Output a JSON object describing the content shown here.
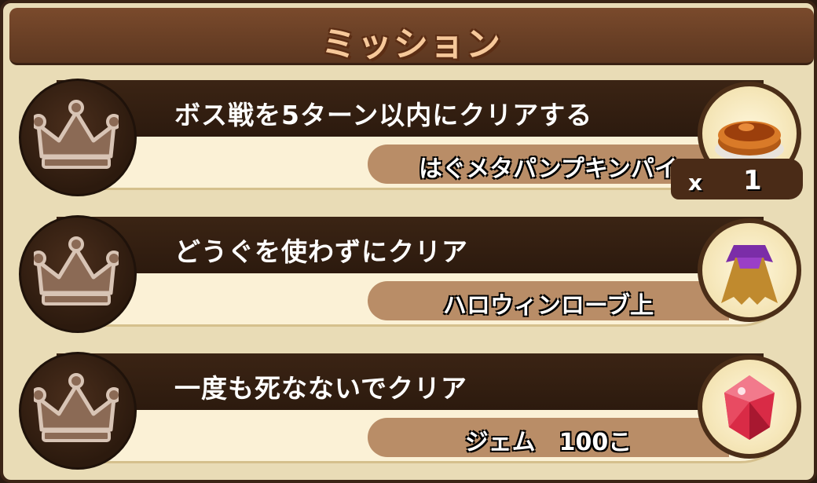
{
  "header": {
    "title": "ミッション"
  },
  "missions": [
    {
      "text": "ボス戦を5ターン以内にクリアする",
      "reward": "はぐメタパンプキンパイ",
      "reward_icon": "pie-icon",
      "qty_x": "x",
      "qty": "1"
    },
    {
      "text": "どうぐを使わずにクリア",
      "reward": "ハロウィンローブ上",
      "reward_icon": "robe-icon"
    },
    {
      "text": "一度も死なないでクリア",
      "reward": "ジェム　100こ",
      "reward_icon": "gem-icon"
    }
  ],
  "colors": {
    "band": "#2c1a0e",
    "panel": "#e9dcb6",
    "reward_tag": "#b98d67",
    "title": "#f6c89a"
  }
}
